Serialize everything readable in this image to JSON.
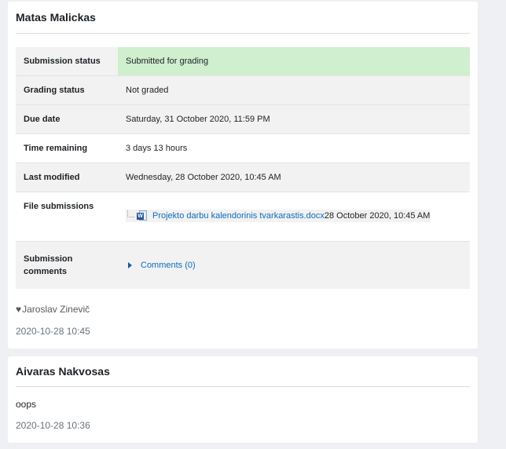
{
  "entries": [
    {
      "title": "Matas Malickas",
      "status_rows": {
        "submission_status": {
          "label": "Submission status",
          "value": "Submitted for grading"
        },
        "grading_status": {
          "label": "Grading status",
          "value": "Not graded"
        },
        "due_date": {
          "label": "Due date",
          "value": "Saturday, 31 October 2020, 11:59 PM"
        },
        "time_remaining": {
          "label": "Time remaining",
          "value": "3 days 13 hours"
        },
        "last_modified": {
          "label": "Last modified",
          "value": "Wednesday, 28 October 2020, 10:45 AM"
        },
        "file_submissions": {
          "label": "File submissions",
          "file_name": "Projekto darbu kalendorinis tvarkarastis.docx",
          "file_date": "28 October 2020, 10:45 AM",
          "icon": "word-doc-icon"
        },
        "submission_comments": {
          "label": "Submission comments",
          "link": "Comments (0)"
        }
      },
      "author_icon": "heart",
      "author": "Jaroslav Zinevič",
      "timestamp": "2020-10-28 10:45"
    },
    {
      "title": "Aivaras Nakvosas",
      "message": "oops",
      "timestamp": "2020-10-28 10:36"
    }
  ],
  "colors": {
    "background": "#eff0f3",
    "submitted_highlight": "#cfefcf",
    "link": "#0f6cbf"
  }
}
